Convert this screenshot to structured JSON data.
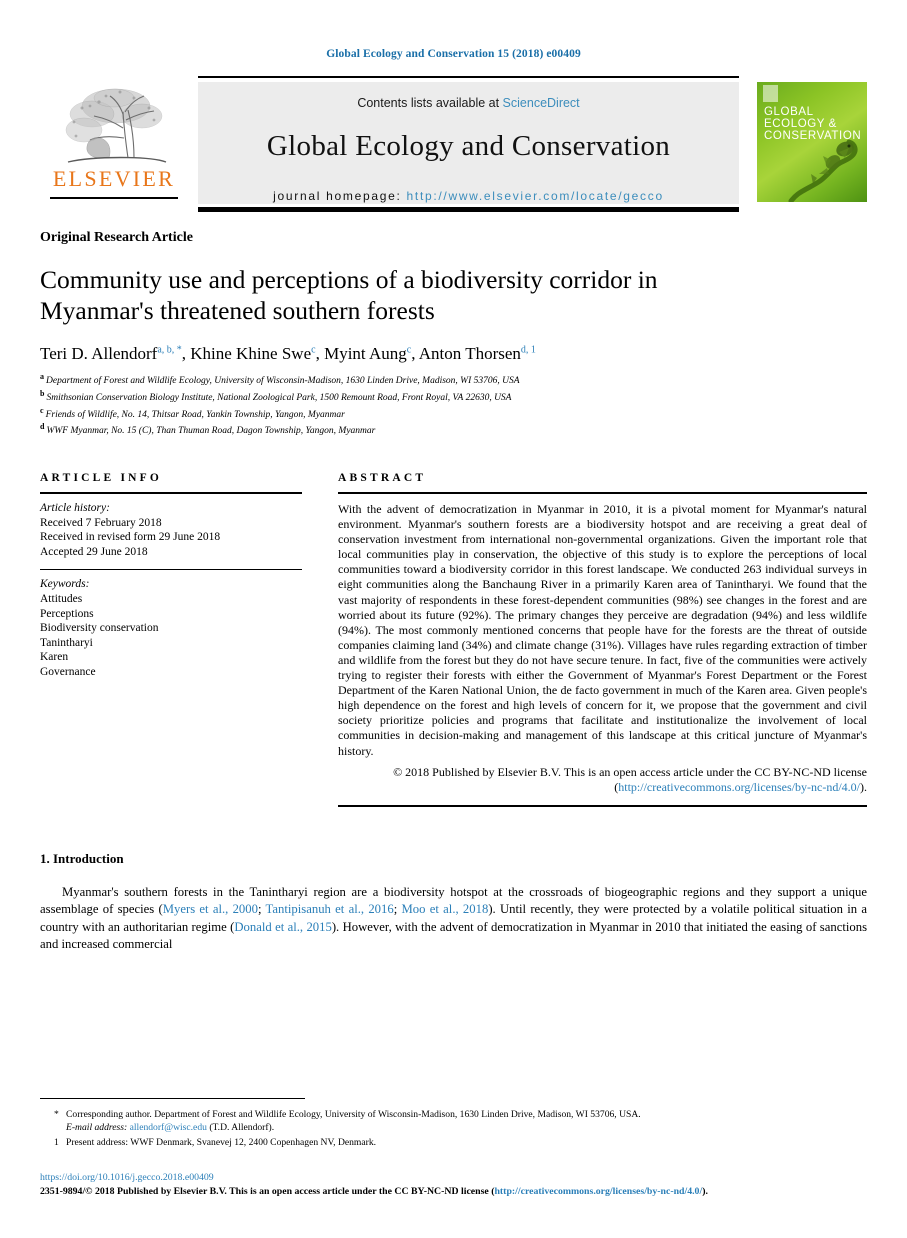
{
  "running_head": "Global Ecology and Conservation 15 (2018) e00409",
  "masthead": {
    "contents_prefix": "Contents lists available at ",
    "contents_link": "ScienceDirect",
    "journal_name": "Global Ecology and Conservation",
    "homepage_label": "journal homepage:",
    "homepage_link": "http://www.elsevier.com/locate/gecco",
    "publisher_logo_text": "ELSEVIER",
    "cover_title": "GLOBAL\nECOLOGY &\nCONSERVATION"
  },
  "article": {
    "type": "Original Research Article",
    "title": "Community use and perceptions of a biodiversity corridor in Myanmar's threatened southern forests",
    "authors": [
      {
        "name": "Teri D. Allendorf",
        "marks": "a, b, *"
      },
      {
        "name": "Khine Khine Swe",
        "marks": "c"
      },
      {
        "name": "Myint Aung",
        "marks": "c"
      },
      {
        "name": "Anton Thorsen",
        "marks": "d, 1"
      }
    ],
    "affiliations": [
      {
        "mark": "a",
        "text": "Department of Forest and Wildlife Ecology, University of Wisconsin-Madison, 1630 Linden Drive, Madison, WI 53706, USA"
      },
      {
        "mark": "b",
        "text": "Smithsonian Conservation Biology Institute, National Zoological Park, 1500 Remount Road, Front Royal, VA 22630, USA"
      },
      {
        "mark": "c",
        "text": "Friends of Wildlife, No. 14, Thitsar Road, Yankin Township, Yangon, Myanmar"
      },
      {
        "mark": "d",
        "text": "WWF Myanmar, No. 15 (C), Than Thuman Road, Dagon Township, Yangon, Myanmar"
      }
    ]
  },
  "article_info": {
    "heading": "ARTICLE INFO",
    "history_label": "Article history:",
    "history": [
      "Received 7 February 2018",
      "Received in revised form 29 June 2018",
      "Accepted 29 June 2018"
    ],
    "keywords_label": "Keywords:",
    "keywords": [
      "Attitudes",
      "Perceptions",
      "Biodiversity conservation",
      "Tanintharyi",
      "Karen",
      "Governance"
    ]
  },
  "abstract": {
    "heading": "ABSTRACT",
    "text": "With the advent of democratization in Myanmar in 2010, it is a pivotal moment for Myanmar's natural environment. Myanmar's southern forests are a biodiversity hotspot and are receiving a great deal of conservation investment from international non-governmental organizations. Given the important role that local communities play in conservation, the objective of this study is to explore the perceptions of local communities toward a biodiversity corridor in this forest landscape. We conducted 263 individual surveys in eight communities along the Banchaung River in a primarily Karen area of Tanintharyi. We found that the vast majority of respondents in these forest-dependent communities (98%) see changes in the forest and are worried about its future (92%). The primary changes they perceive are degradation (94%) and less wildlife (94%). The most commonly mentioned concerns that people have for the forests are the threat of outside companies claiming land (34%) and climate change (31%). Villages have rules regarding extraction of timber and wildlife from the forest but they do not have secure tenure. In fact, five of the communities were actively trying to register their forests with either the Government of Myanmar's Forest Department or the Forest Department of the Karen National Union, the de facto government in much of the Karen area. Given people's high dependence on the forest and high levels of concern for it, we propose that the government and civil society prioritize policies and programs that facilitate and institutionalize the involvement of local communities in decision-making and management of this landscape at this critical juncture of Myanmar's history.",
    "copyright_pre": "© 2018 Published by Elsevier B.V. This is an open access article under the CC BY-NC-ND license (",
    "copyright_link": "http://creativecommons.org/licenses/by-nc-nd/4.0/",
    "copyright_post": ")."
  },
  "introduction": {
    "heading": "1. Introduction",
    "para_1_a": "Myanmar's southern forests in the Tanintharyi region are a biodiversity hotspot at the crossroads of biogeographic regions and they support a unique assemblage of species (",
    "cite_1": "Myers et al., 2000",
    "sep_1": "; ",
    "cite_2": "Tantipisanuh et al., 2016",
    "sep_2": "; ",
    "cite_3": "Moo et al., 2018",
    "para_1_b": "). Until recently, they were protected by a volatile political situation in a country with an authoritarian regime (",
    "cite_4": "Donald et al., 2015",
    "para_1_c": "). However, with the advent of democratization in Myanmar in 2010 that initiated the easing of sanctions and increased commercial"
  },
  "footnotes": {
    "corresponding_mark": "*",
    "corresponding_text": "Corresponding author. Department of Forest and Wildlife Ecology, University of Wisconsin-Madison, 1630 Linden Drive, Madison, WI 53706, USA.",
    "email_label": "E-mail address:",
    "email_link": "allendorf@wisc.edu",
    "email_suffix": "(T.D. Allendorf).",
    "present_mark": "1",
    "present_text": "Present address: WWF Denmark, Svanevej 12, 2400 Copenhagen NV, Denmark."
  },
  "imprint": {
    "doi": "https://doi.org/10.1016/j.gecco.2018.e00409",
    "issn_pre": "2351-9894/© 2018 Published by Elsevier B.V. This is an open access article under the CC BY-NC-ND license (",
    "issn_link": "http://creativecommons.org/licenses/by-nc-nd/4.0/",
    "issn_post": ")."
  },
  "colors": {
    "link": "#2b7fb8",
    "running_head": "#1a6fa8",
    "elsevier_orange": "#E8761A",
    "masthead_bg": "#ececec",
    "cover_green": "#8cc425"
  }
}
